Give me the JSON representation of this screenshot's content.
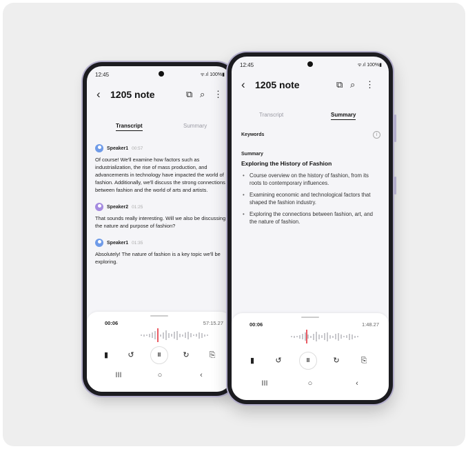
{
  "back_phone": {
    "status": {
      "time": "12:45",
      "icons": "ᯤ.ıl 100%▮"
    },
    "header": {
      "back_icon": "chevron-left-icon",
      "title": "1205 note",
      "copy_icon": "copy-icon",
      "search_icon": "search-icon",
      "more_icon": "more-vertical-icon"
    },
    "tabs": {
      "transcript": "Transcript",
      "summary": "Summary",
      "active": "transcript"
    },
    "transcript": [
      {
        "speaker": "Speaker1",
        "time": "00:57",
        "avatar_color": "#6f9be8",
        "text": "Of course! We'll examine how factors such as industrialization, the rise of mass production, and advancements in technology have impacted the world of fashion. Additionally, we'll discuss the strong connections between fashion and the world of arts and artists."
      },
      {
        "speaker": "Speaker2",
        "time": "01:25",
        "avatar_color": "#a58be0",
        "text": "That sounds really interesting. Will we also be discussing the nature and purpose of fashion?"
      },
      {
        "speaker": "Speaker1",
        "time": "01:35",
        "avatar_color": "#6f9be8",
        "text": "Absolutely! The nature of fashion is a key topic we'll be exploring."
      }
    ],
    "player": {
      "current": "00:06",
      "total": "57:15.27"
    }
  },
  "front_phone": {
    "status": {
      "time": "12:45",
      "icons": "ᯤ.ıl 100%▮"
    },
    "header": {
      "back_icon": "chevron-left-icon",
      "title": "1205 note",
      "copy_icon": "copy-icon",
      "search_icon": "search-icon",
      "more_icon": "more-vertical-icon"
    },
    "tabs": {
      "transcript": "Transcript",
      "summary": "Summary",
      "active": "summary"
    },
    "summary": {
      "keywords_label": "Keywords",
      "section_label": "Summary",
      "heading": "Exploring the History of Fashion",
      "bullets": [
        "Course overview on the history of fashion, from its roots to contemporary influences.",
        "Examining economic and technological factors that shaped the fashion industry.",
        "Exploring the connections between fashion, art, and the nature of fashion."
      ]
    },
    "player": {
      "current": "00:06",
      "total": "1:48.27"
    }
  },
  "player_controls": {
    "bookmark_icon": "bookmark-icon",
    "rewind_icon": "rewind-icon",
    "pause_label": "II",
    "forward_icon": "forward-icon",
    "export_icon": "export-icon"
  },
  "nav": {
    "recent": "III",
    "home": "○",
    "back": "‹"
  },
  "glyphs": {
    "back": "‹",
    "copy": "⧉",
    "search": "⌕",
    "more": "⋮",
    "info": "i",
    "bookmark": "▮",
    "rewind": "↺",
    "forward": "↻",
    "export": "⎘"
  },
  "colors": {
    "accent_red": "#ea5a63",
    "frame": "#b3aecb",
    "background": "#eeeeee"
  }
}
